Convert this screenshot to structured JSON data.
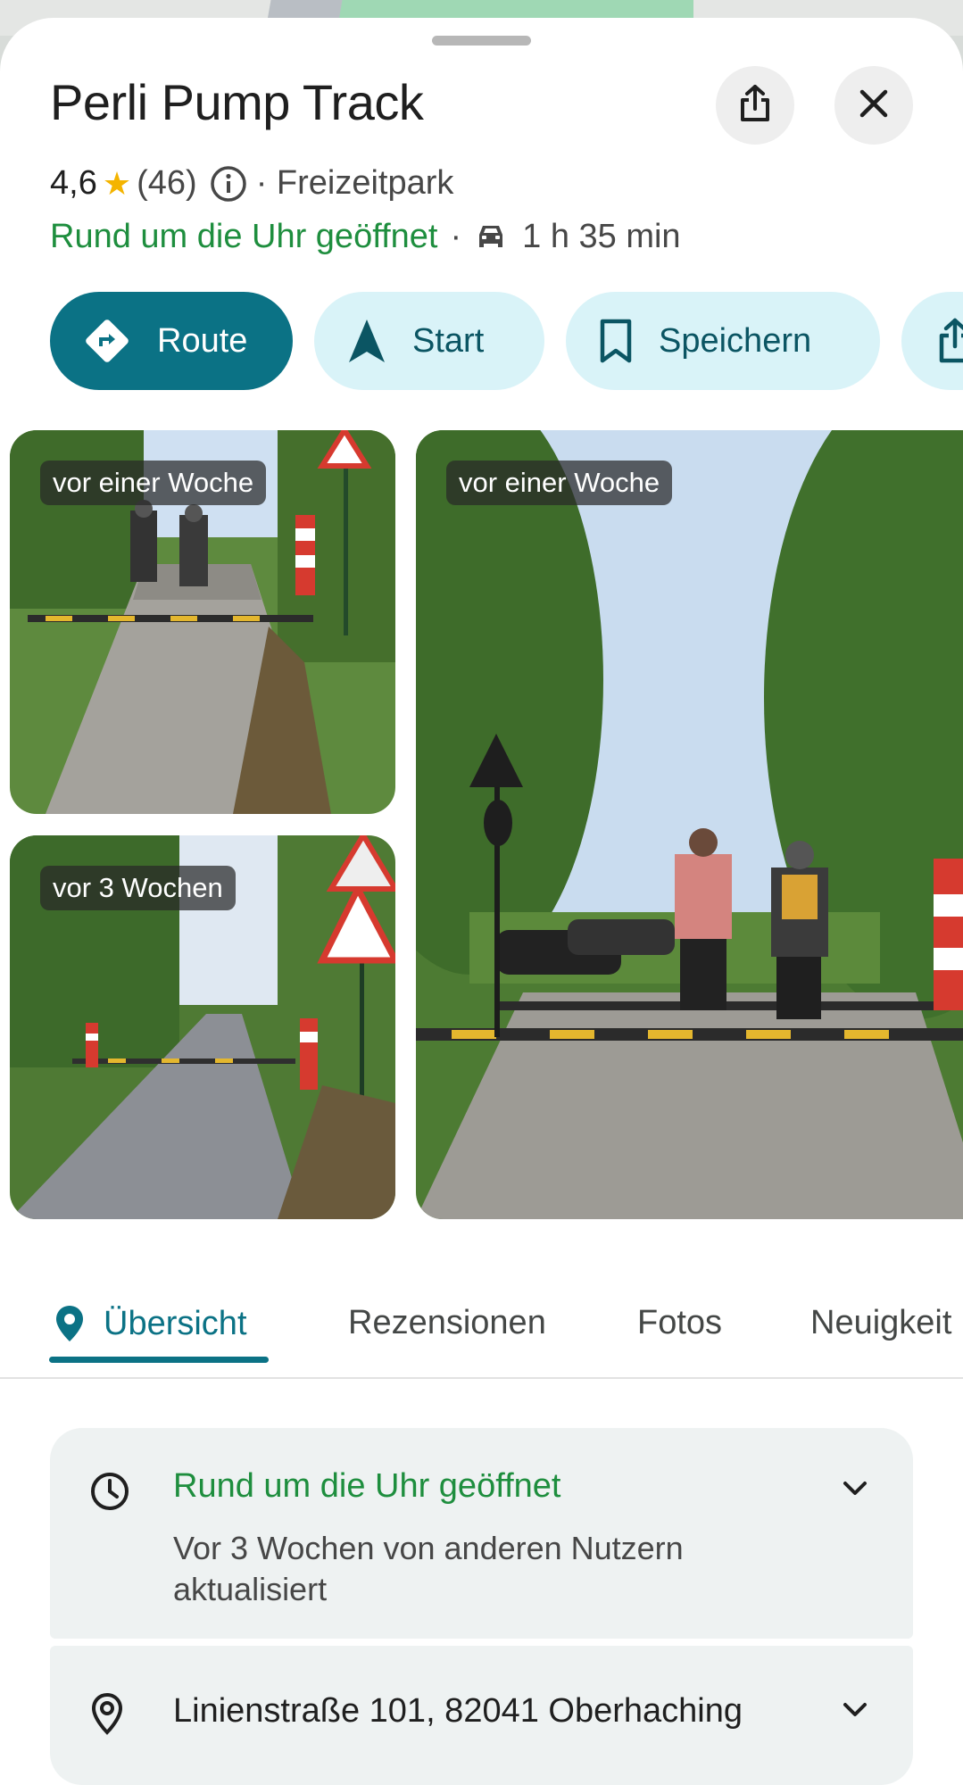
{
  "place": {
    "name": "Perli Pump Track",
    "rating": "4,6",
    "reviews_count": "(46)",
    "category": "· Freizeitpark",
    "open_status": "Rund um die Uhr geöffnet",
    "separator": "·",
    "drive_time": "1 h 35 min"
  },
  "header_buttons": {
    "share_icon": "share-icon",
    "close_icon": "close-icon"
  },
  "actions": [
    {
      "label": "Route",
      "icon": "directions-icon"
    },
    {
      "label": "Start",
      "icon": "navigation-arrow-icon"
    },
    {
      "label": "Speichern",
      "icon": "bookmark-icon"
    },
    {
      "label": "",
      "icon": "share-icon"
    }
  ],
  "photos": [
    {
      "timestamp": "vor einer Woche"
    },
    {
      "timestamp": "vor 3 Wochen"
    },
    {
      "timestamp": "vor einer Woche"
    }
  ],
  "tabs": [
    {
      "label": "Übersicht",
      "active": true
    },
    {
      "label": "Rezensionen"
    },
    {
      "label": "Fotos"
    },
    {
      "label": "Neuigkeit"
    }
  ],
  "details": {
    "hours_title": "Rund um die Uhr geöffnet",
    "hours_subtitle": "Vor 3 Wochen von anderen Nutzern aktualisiert",
    "address": "Linienstraße 101, 82041 Oberhaching"
  },
  "colors": {
    "accent": "#0b7285",
    "open_green": "#1e8e3e",
    "star": "#f4b400",
    "chip_bg": "#d9f3f8"
  }
}
